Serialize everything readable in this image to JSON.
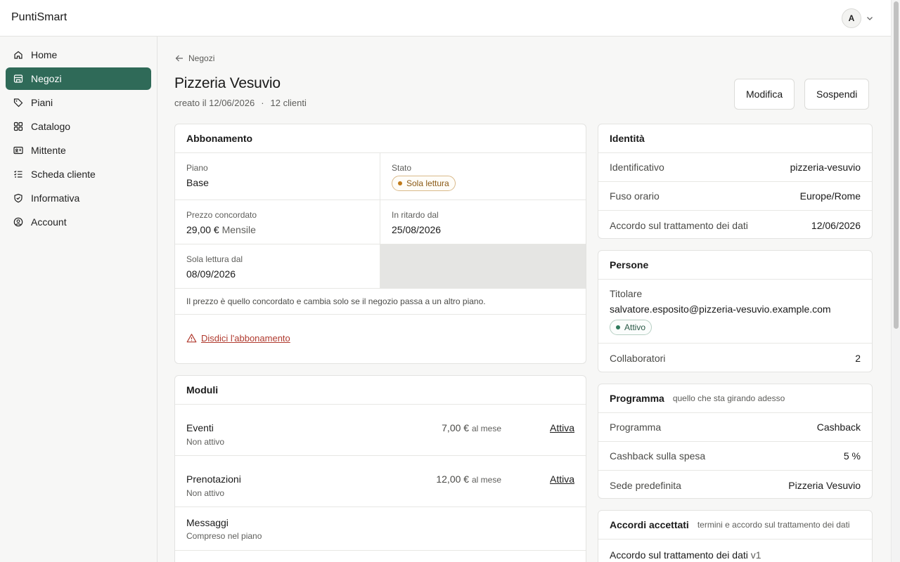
{
  "app": {
    "brand": "PuntiSmart",
    "avatar_initial": "A"
  },
  "sidebar": {
    "items": [
      {
        "label": "Home",
        "icon": "home-icon"
      },
      {
        "label": "Negozi",
        "icon": "store-icon",
        "active": true
      },
      {
        "label": "Piani",
        "icon": "tag-icon"
      },
      {
        "label": "Catalogo",
        "icon": "grid-icon"
      },
      {
        "label": "Mittente",
        "icon": "id-card-icon"
      },
      {
        "label": "Scheda cliente",
        "icon": "checklist-icon"
      },
      {
        "label": "Informativa",
        "icon": "shield-icon"
      },
      {
        "label": "Account",
        "icon": "user-circle-icon"
      }
    ]
  },
  "header": {
    "back_label": "Negozi",
    "title": "Pizzeria Vesuvio",
    "created": "creato il 12/06/2026",
    "separator": "·",
    "clients": "12 clienti",
    "edit_button": "Modifica",
    "suspend_button": "Sospendi"
  },
  "subscription": {
    "title": "Abbonamento",
    "plan_label": "Piano",
    "plan_value": "Base",
    "status_label": "Stato",
    "status_value": "Sola lettura",
    "price_label": "Prezzo concordato",
    "price_value": "29,00 €",
    "price_period": "Mensile",
    "late_label": "In ritardo dal",
    "late_value": "25/08/2026",
    "readonly_label": "Sola lettura dal",
    "readonly_value": "08/09/2026",
    "note": "Il prezzo è quello concordato e cambia solo se il negozio passa a un altro piano.",
    "cancel_label": "Disdici l'abbonamento"
  },
  "modules": {
    "title": "Moduli",
    "items": [
      {
        "name": "Eventi",
        "status": "Non attivo",
        "price": "7,00 €",
        "period": "al mese",
        "action": "Attiva"
      },
      {
        "name": "Prenotazioni",
        "status": "Non attivo",
        "price": "12,00 €",
        "period": "al mese",
        "action": "Attiva"
      },
      {
        "name": "Messaggi",
        "status": "Compreso nel piano"
      }
    ]
  },
  "identity": {
    "title": "Identità",
    "rows": [
      {
        "k": "Identificativo",
        "v": "pizzeria-vesuvio"
      },
      {
        "k": "Fuso orario",
        "v": "Europe/Rome"
      },
      {
        "k": "Accordo sul trattamento dei dati",
        "v": "12/06/2026"
      }
    ]
  },
  "people": {
    "title": "Persone",
    "owner_label": "Titolare",
    "owner_email": "salvatore.esposito@pizzeria-vesuvio.example.com",
    "owner_status": "Attivo",
    "collab_label": "Collaboratori",
    "collab_value": "2"
  },
  "program": {
    "title": "Programma",
    "subtitle": "quello che sta girando adesso",
    "rows": [
      {
        "k": "Programma",
        "v": "Cashback"
      },
      {
        "k": "Cashback sulla spesa",
        "v": "5 %"
      },
      {
        "k": "Sede predefinita",
        "v": "Pizzeria Vesuvio"
      }
    ]
  },
  "agreements": {
    "title": "Accordi accettati",
    "subtitle": "termini e accordo sul trattamento dei dati",
    "first_item": "Accordo sul trattamento dei dati",
    "first_version": "v1"
  },
  "colors": {
    "accent": "#2f6a58",
    "danger": "#b03a2e",
    "warning": "#c07a1a"
  }
}
